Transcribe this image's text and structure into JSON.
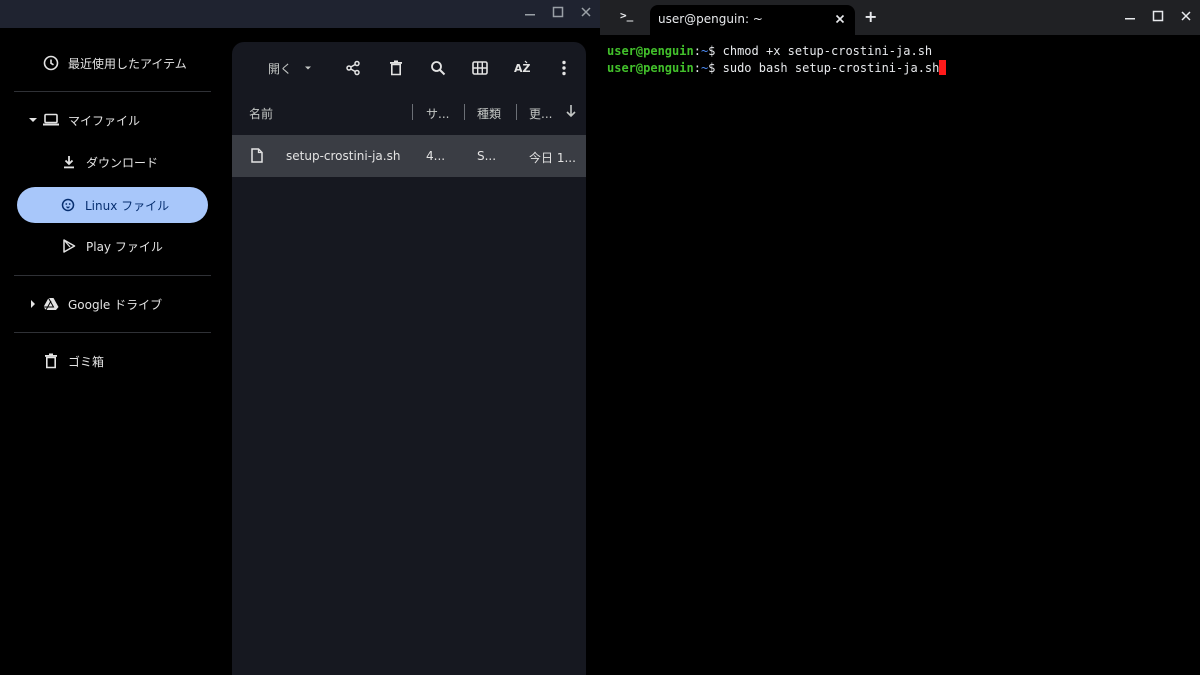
{
  "files_app": {
    "window_controls": [
      "minimize",
      "maximize",
      "close"
    ],
    "sidebar": {
      "recent": "最近使用したアイテム",
      "my_files": "マイファイル",
      "downloads": "ダウンロード",
      "linux_files": "Linux ファイル",
      "play_files": "Play ファイル",
      "google_drive": "Google ドライブ",
      "trash": "ゴミ箱",
      "selected": "Linux ファイル"
    },
    "toolbar": {
      "open_label": "開く",
      "icons": [
        "share-icon",
        "delete-icon",
        "search-icon",
        "grid-view-icon",
        "sort-icon",
        "more-vert-icon"
      ]
    },
    "columns": {
      "name": "名前",
      "size": "サ...",
      "type": "種類",
      "modified": "更..."
    },
    "files": [
      {
        "name": "setup-crostini-ja.sh",
        "size": "4...",
        "type": "S...",
        "modified": "今日 1..."
      }
    ],
    "colors": {
      "selected_nav": "#a8c7fa",
      "panel": "#161820",
      "selected_row": "#3a3d44"
    }
  },
  "terminal": {
    "tab_title": "user@penguin: ~",
    "tab_icon": ">_",
    "new_tab": "+",
    "lines": [
      {
        "user": "user@penguin",
        "sep": ":",
        "path": "~",
        "symbol": "$",
        "command": " chmod +x setup-crostini-ja.sh"
      },
      {
        "user": "user@penguin",
        "sep": ":",
        "path": "~",
        "symbol": "$",
        "command": " sudo bash setup-crostini-ja.sh"
      }
    ],
    "colors": {
      "prompt_user": "#42c02b",
      "prompt_path": "#4d8cf7",
      "cursor": "#ff1a1a"
    }
  }
}
